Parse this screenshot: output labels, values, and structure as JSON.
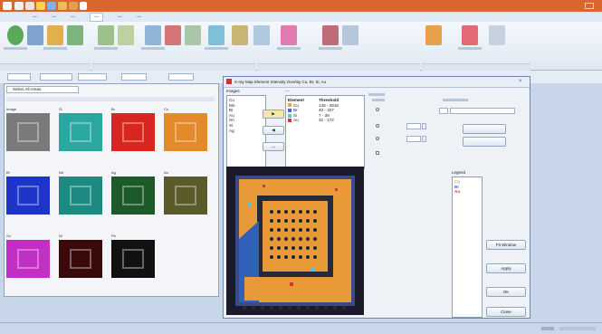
{
  "dialog": {
    "title": "X-ray Map Element Intensity Overlay Cu, Br, Si, Au",
    "images_header": "Images",
    "images": [
      "Cu",
      "Mo",
      "Br",
      "Au",
      "Sn",
      "Si",
      "Ag"
    ],
    "overlay_header": "Element",
    "threshold_header": "Threshold",
    "overlay_rows": [
      {
        "name": "Cu",
        "threshold": "148 - 2815",
        "color": "#f0a33a"
      },
      {
        "name": "Br",
        "threshold": "40 - 327",
        "color": "#3b6fd6"
      },
      {
        "name": "Si",
        "threshold": "7 - 38",
        "color": "#58c8d8"
      },
      {
        "name": "Au",
        "threshold": "32 - 172",
        "color": "#d23a3a"
      }
    ],
    "legend_header": "Legend",
    "legend": [
      {
        "name": "Cu",
        "color": "#f0a33a"
      },
      {
        "name": "Br",
        "color": "#3b6fd6"
      },
      {
        "name": "Au",
        "color": "#d23a3a"
      }
    ],
    "buttons": {
      "ok": "OK",
      "cancel": "Close",
      "apply": "Apply",
      "fit": "Fit Window"
    }
  },
  "leftpanel": {
    "tab": "Select All Areas",
    "thumbs": [
      {
        "label": "Image",
        "color": "#7a7a7a"
      },
      {
        "label": "Si",
        "color": "#2aa7a0"
      },
      {
        "label": "Br",
        "color": "#d8261f"
      },
      {
        "label": "Cu",
        "color": "#e58a2a"
      },
      {
        "label": "Br",
        "color": "#1d35c9"
      },
      {
        "label": "Nd",
        "color": "#1d8a82"
      },
      {
        "label": "Ag",
        "color": "#1d5a2a"
      },
      {
        "label": "Au",
        "color": "#5a5a2a"
      },
      {
        "label": "Sn",
        "color": "#c22fc4"
      },
      {
        "label": "Ni",
        "color": "#3a0a0a"
      },
      {
        "label": "Pb",
        "color": "#111111"
      }
    ]
  },
  "titlebar": {
    "color": "#d9662e"
  }
}
